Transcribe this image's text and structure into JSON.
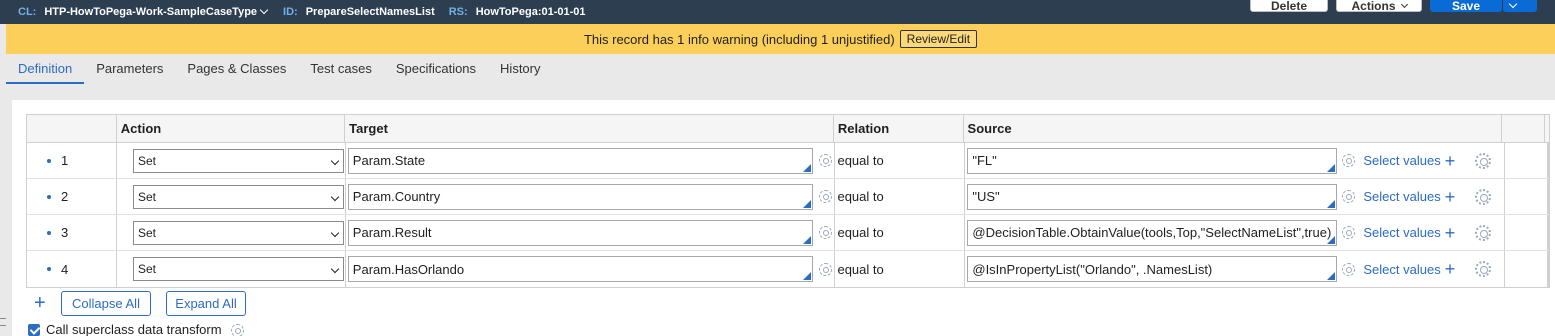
{
  "header": {
    "cl_key": "CL:",
    "cl_value": "HTP-HowToPega-Work-SampleCaseType",
    "id_key": "ID:",
    "id_value": "PrepareSelectNamesList",
    "rs_key": "RS:",
    "rs_value": "HowToPega:01-01-01",
    "delete_label": "Delete",
    "actions_label": "Actions",
    "save_label": "Save"
  },
  "warning": {
    "text": "This record has 1 info warning (including 1 unjustified)",
    "review_label": "Review/Edit"
  },
  "tabs": [
    {
      "label": "Definition",
      "active": true
    },
    {
      "label": "Parameters"
    },
    {
      "label": "Pages & Classes"
    },
    {
      "label": "Test cases"
    },
    {
      "label": "Specifications"
    },
    {
      "label": "History"
    }
  ],
  "grid": {
    "columns": [
      "",
      "Action",
      "Target",
      "Relation",
      "Source",
      "",
      ""
    ],
    "rows": [
      {
        "num": "1",
        "action": "Set",
        "target": "Param.State",
        "relation": "equal to",
        "source": "\"FL\"",
        "select_values": "Select values"
      },
      {
        "num": "2",
        "action": "Set",
        "target": "Param.Country",
        "relation": "equal to",
        "source": "\"US\"",
        "select_values": "Select values"
      },
      {
        "num": "3",
        "action": "Set",
        "target": "Param.Result",
        "relation": "equal to",
        "source": "@DecisionTable.ObtainValue(tools,Top,\"SelectNameList\",true)",
        "select_values": "Select values"
      },
      {
        "num": "4",
        "action": "Set",
        "target": "Param.HasOrlando",
        "relation": "equal to",
        "source": "@IsInPropertyList(\"Orlando\", .NamesList)",
        "select_values": "Select values"
      }
    ]
  },
  "footer": {
    "add_symbol": "+",
    "collapse_all": "Collapse All",
    "expand_all": "Expand All",
    "superclass_label": "Call superclass data transform",
    "superclass_checked": true
  },
  "colors": {
    "header_bg": "#2c3e50",
    "warning_bg": "#fbcf5a",
    "accent": "#2b6cc4",
    "save_bg": "#0a6bd6"
  }
}
